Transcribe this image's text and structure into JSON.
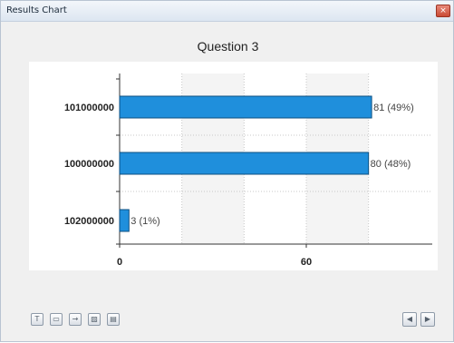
{
  "window": {
    "title": "Results Chart",
    "close_glyph": "×"
  },
  "chart_data": {
    "type": "bar",
    "orientation": "horizontal",
    "title": "Question 3",
    "categories": [
      "101000000",
      "100000000",
      "102000000"
    ],
    "values": [
      81,
      80,
      3
    ],
    "data_labels": [
      "81 (49%)",
      "80 (48%)",
      "3 (1%)"
    ],
    "x_tick_labels": [
      "0",
      "60"
    ],
    "xlim": [
      0,
      90
    ],
    "grid": true,
    "bar_color": "#1f8fdc"
  },
  "toolbar": {
    "buttons": [
      {
        "icon": "text-format-icon",
        "glyph": "T"
      },
      {
        "icon": "window-icon",
        "glyph": "▭"
      },
      {
        "icon": "arrow-right-box-icon",
        "glyph": "→"
      },
      {
        "icon": "image-export-icon",
        "glyph": "▨"
      },
      {
        "icon": "chart-export-icon",
        "glyph": "▤"
      }
    ],
    "prev_glyph": "◀",
    "next_glyph": "▶"
  }
}
